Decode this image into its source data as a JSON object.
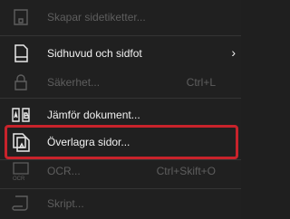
{
  "menu": {
    "items": [
      {
        "label": "Skapar sidetiketter...",
        "shortcut": "",
        "enabled": false,
        "icon": "page-label-icon"
      },
      {
        "label": "Sidhuvud och sidfot",
        "shortcut": "",
        "enabled": true,
        "icon": "header-footer-icon",
        "submenu_arrow": "›"
      },
      {
        "label": "Säkerhet...",
        "shortcut": "Ctrl+L",
        "enabled": false,
        "icon": "lock-icon"
      },
      {
        "label": "Jämför dokument...",
        "shortcut": "",
        "enabled": true,
        "icon": "compare-documents-icon"
      },
      {
        "label": "Överlagra sidor...",
        "shortcut": "",
        "enabled": true,
        "icon": "overlay-pages-icon",
        "highlighted": true
      },
      {
        "label": "OCR...",
        "shortcut": "Ctrl+Skift+O",
        "enabled": false,
        "icon": "ocr-icon"
      },
      {
        "label": "Skript...",
        "shortcut": "",
        "enabled": false,
        "icon": "script-icon"
      }
    ]
  },
  "colors": {
    "background": "#202020",
    "text_enabled": "#f2f2f2",
    "text_disabled": "#5e5e5e",
    "highlight_border": "#c8232b"
  }
}
